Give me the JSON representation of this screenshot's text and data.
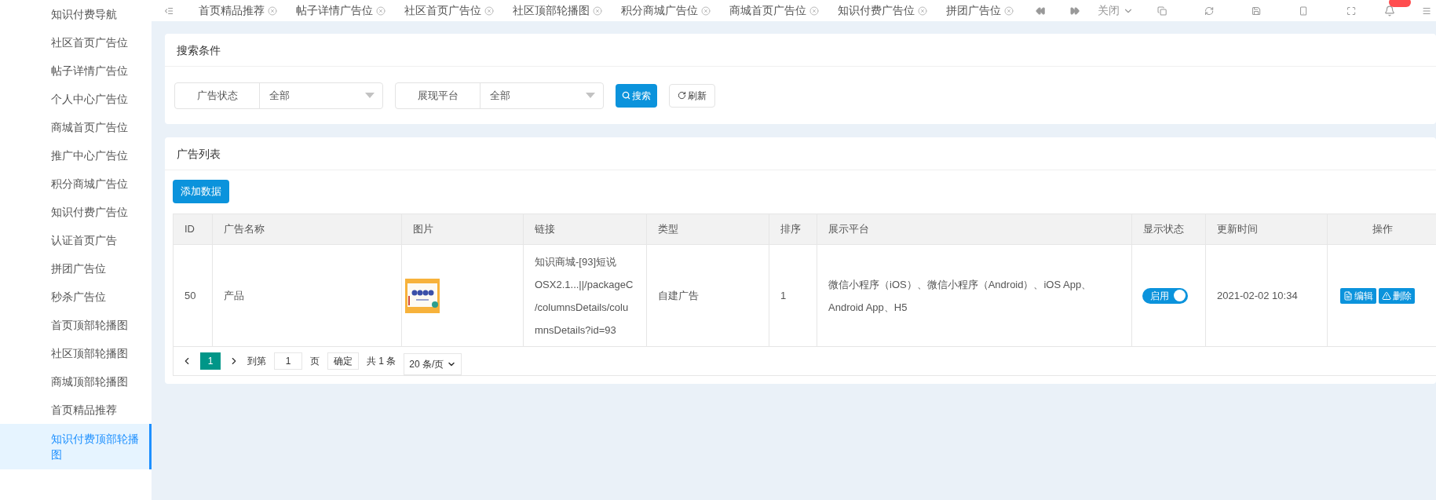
{
  "sidebar": {
    "items": [
      {
        "label": "知识付费导航",
        "selected": false
      },
      {
        "label": "社区首页广告位",
        "selected": false
      },
      {
        "label": "帖子详情广告位",
        "selected": false
      },
      {
        "label": "个人中心广告位",
        "selected": false
      },
      {
        "label": "商城首页广告位",
        "selected": false
      },
      {
        "label": "推广中心广告位",
        "selected": false
      },
      {
        "label": "积分商城广告位",
        "selected": false
      },
      {
        "label": "知识付费广告位",
        "selected": false
      },
      {
        "label": "认证首页广告",
        "selected": false
      },
      {
        "label": "拼团广告位",
        "selected": false
      },
      {
        "label": "秒杀广告位",
        "selected": false
      },
      {
        "label": "首页顶部轮播图",
        "selected": false
      },
      {
        "label": "社区顶部轮播图",
        "selected": false
      },
      {
        "label": "商城顶部轮播图",
        "selected": false
      },
      {
        "label": "首页精品推荐",
        "selected": false
      },
      {
        "label": "知识付费顶部轮播图",
        "selected": true
      }
    ]
  },
  "tabs": [
    {
      "label": "首页精品推荐"
    },
    {
      "label": "帖子详情广告位"
    },
    {
      "label": "社区首页广告位"
    },
    {
      "label": "社区顶部轮播图"
    },
    {
      "label": "积分商城广告位"
    },
    {
      "label": "商城首页广告位"
    },
    {
      "label": "知识付费广告位"
    },
    {
      "label": "拼团广告位"
    }
  ],
  "toolbar": {
    "close_menu": "关闭"
  },
  "search": {
    "title": "搜索条件",
    "filters": [
      {
        "label": "广告状态",
        "value": "全部"
      },
      {
        "label": "展现平台",
        "value": "全部"
      }
    ],
    "search_button": "搜索",
    "refresh_button": "刷新"
  },
  "list": {
    "title": "广告列表",
    "add_button": "添加数据",
    "table": {
      "columns": [
        "ID",
        "广告名称",
        "图片",
        "链接",
        "类型",
        "排序",
        "展示平台",
        "显示状态",
        "更新时间",
        "操作"
      ],
      "rows": [
        {
          "id": "50",
          "name": "产品",
          "link": "知识商城-[93]短说OSX2.1...||/packageC/columnsDetails/columnsDetails?id=93",
          "type": "自建广告",
          "order": "1",
          "platform": "微信小程序（iOS）、微信小程序（Android）、iOS App、Android App、H5",
          "status": {
            "label": "启用",
            "on": true
          },
          "updated": "2021-02-02 10:34",
          "actions": [
            "编辑",
            "删除"
          ]
        }
      ]
    },
    "pagination": {
      "current": "1",
      "goto_label": "到第",
      "page_input": "1",
      "page_unit": "页",
      "confirm": "确定",
      "total": "共 1 条",
      "page_size": "20 条/页"
    }
  }
}
